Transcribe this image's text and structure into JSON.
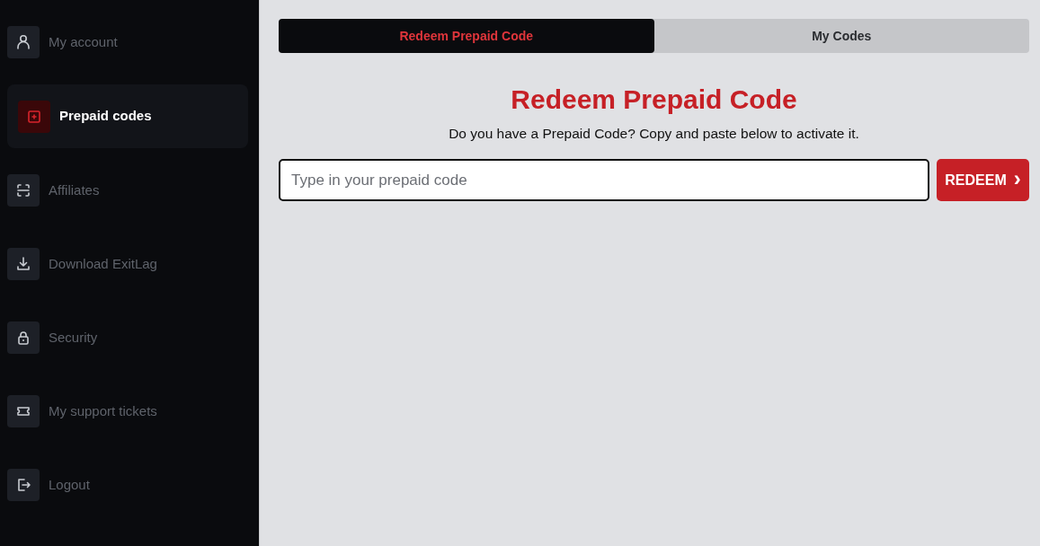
{
  "sidebar": {
    "items": [
      {
        "label": "My account",
        "selected": false
      },
      {
        "label": "Prepaid codes",
        "selected": true
      },
      {
        "label": "Affiliates",
        "selected": false
      },
      {
        "label": "Download ExitLag",
        "selected": false
      },
      {
        "label": "Security",
        "selected": false
      },
      {
        "label": "My support tickets",
        "selected": false
      },
      {
        "label": "Logout",
        "selected": false
      }
    ]
  },
  "tabs": [
    {
      "label": "Redeem Prepaid Code",
      "selected": true
    },
    {
      "label": "My Codes",
      "selected": false
    }
  ],
  "heading": "Redeem Prepaid Code",
  "subtitle": "Do you have a Prepaid Code? Copy and paste below to activate it.",
  "code_field": {
    "placeholder": "Type in your prepaid code"
  },
  "redeem_button": {
    "label": "REDEEM",
    "icon": "›"
  }
}
